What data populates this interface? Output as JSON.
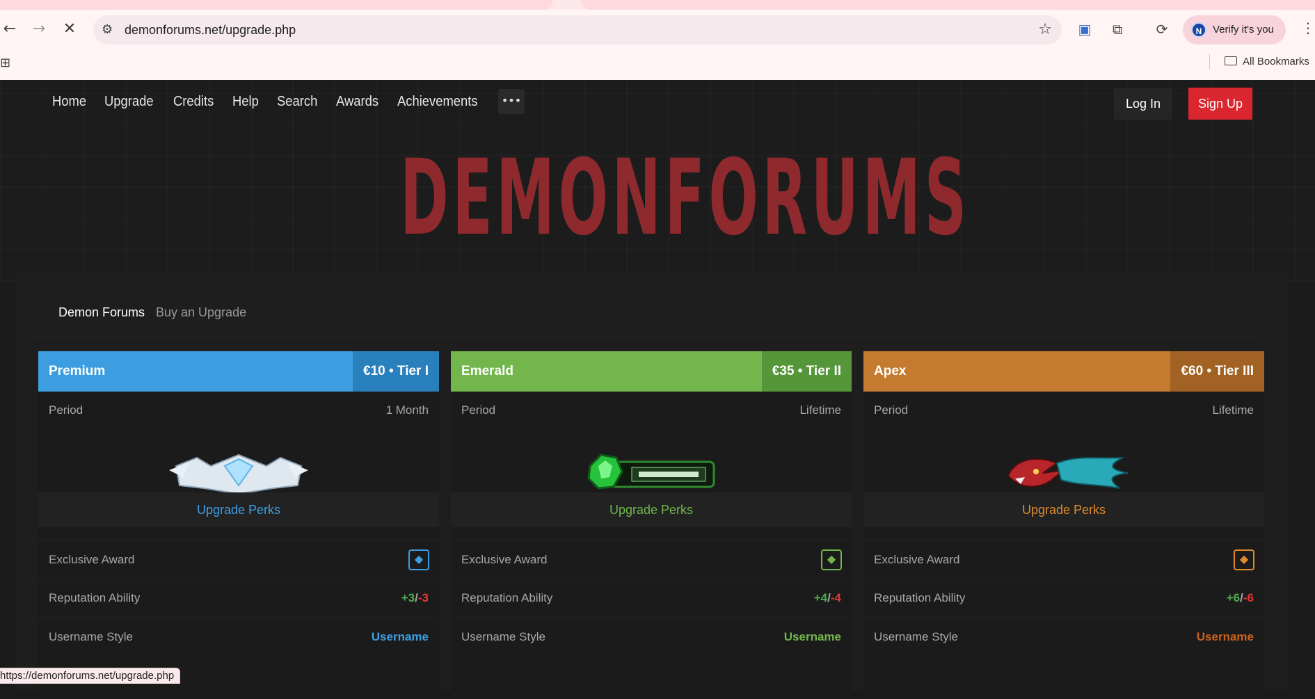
{
  "browser": {
    "url": "demonforums.net/upgrade.php",
    "verify_label": "Verify it's you",
    "avatar_letter": "N",
    "bookmarks_label": "All Bookmarks",
    "status_url": "https://demonforums.net/upgrade.php"
  },
  "nav": {
    "items": [
      "Home",
      "Upgrade",
      "Credits",
      "Help",
      "Search",
      "Awards",
      "Achievements"
    ],
    "more": "•••",
    "login": "Log In",
    "signup": "Sign Up"
  },
  "logo": "DEMONFORUMS",
  "breadcrumb": [
    "Demon Forums",
    "Buy an Upgrade"
  ],
  "colors": {
    "premium": "#3c9ee0",
    "emerald": "#72b64c",
    "apex": "#c57b2f",
    "logo": "#8e2a2e",
    "signup": "#d9262f"
  },
  "plans": [
    {
      "name": "Premium",
      "price": "€10 • Tier I",
      "period_label": "Period",
      "period": "1 Month",
      "perks": "Upgrade Perks",
      "award_label": "Exclusive Award",
      "rep_label": "Reputation Ability",
      "rep_plus": "+3",
      "rep_sep": "/",
      "rep_minus": "-3",
      "style_label": "Username Style",
      "style_value": "Username"
    },
    {
      "name": "Emerald",
      "price": "€35 • Tier II",
      "period_label": "Period",
      "period": "Lifetime",
      "perks": "Upgrade Perks",
      "award_label": "Exclusive Award",
      "rep_label": "Reputation Ability",
      "rep_plus": "+4",
      "rep_sep": "/",
      "rep_minus": "-4",
      "style_label": "Username Style",
      "style_value": "Username"
    },
    {
      "name": "Apex",
      "price": "€60 • Tier III",
      "period_label": "Period",
      "period": "Lifetime",
      "perks": "Upgrade Perks",
      "award_label": "Exclusive Award",
      "rep_label": "Reputation Ability",
      "rep_plus": "+6",
      "rep_sep": "/",
      "rep_minus": "-6",
      "style_label": "Username Style",
      "style_value": "Username"
    }
  ]
}
